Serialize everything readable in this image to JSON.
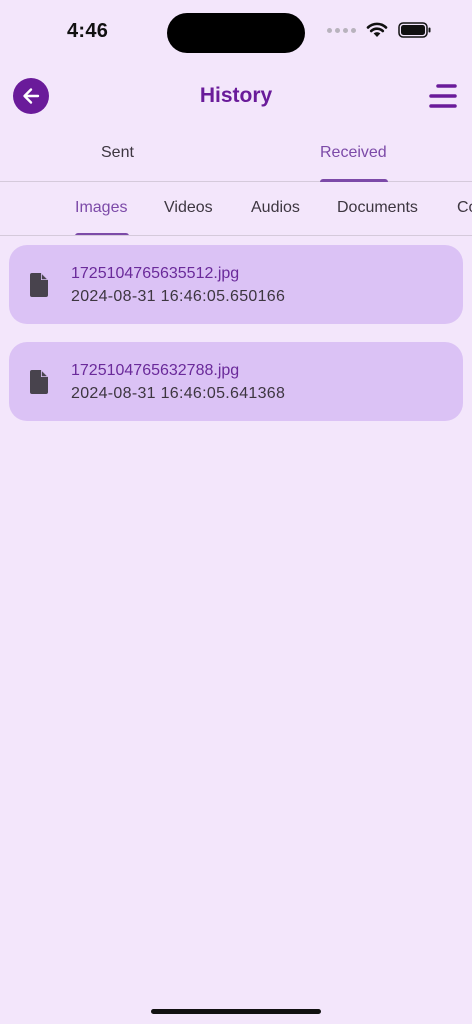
{
  "status_bar": {
    "time": "4:46"
  },
  "header": {
    "title": "History",
    "back_icon": "arrow-left-icon",
    "menu_icon": "menu-icon",
    "accent_color": "#6a1b9a"
  },
  "primary_tabs": [
    {
      "label": "Sent",
      "active": false
    },
    {
      "label": "Received",
      "active": true
    }
  ],
  "secondary_tabs": [
    {
      "label": "Images",
      "active": true
    },
    {
      "label": "Videos",
      "active": false
    },
    {
      "label": "Audios",
      "active": false
    },
    {
      "label": "Documents",
      "active": false
    },
    {
      "label": "Co",
      "active": false
    }
  ],
  "files": [
    {
      "name": "1725104765635512.jpg",
      "date": "2024-08-31 16:46:05.650166",
      "icon": "file-icon"
    },
    {
      "name": "1725104765632788.jpg",
      "date": "2024-08-31 16:46:05.641368",
      "icon": "file-icon"
    }
  ],
  "colors": {
    "background": "#f3e6fb",
    "card": "#dbc2f5",
    "tab_active": "#7c4aa8"
  }
}
